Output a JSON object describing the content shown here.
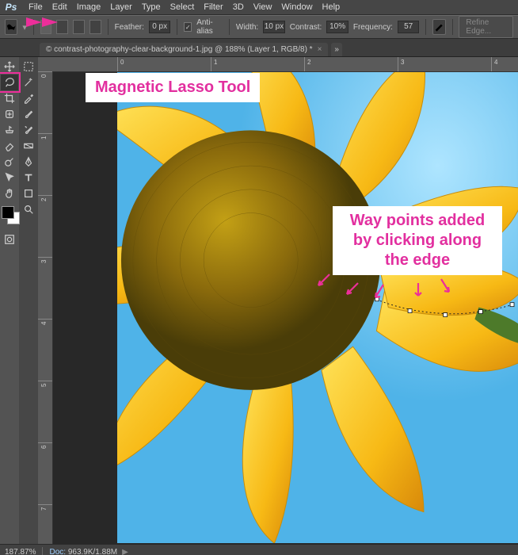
{
  "logo": "Ps",
  "menu": [
    "File",
    "Edit",
    "Image",
    "Layer",
    "Type",
    "Select",
    "Filter",
    "3D",
    "View",
    "Window",
    "Help"
  ],
  "options": {
    "feather_label": "Feather:",
    "feather": "0 px",
    "anti_label": "Anti-alias",
    "anti_checked": "✓",
    "width_label": "Width:",
    "width": "10 px",
    "contrast_label": "Contrast:",
    "contrast": "10%",
    "frequency_label": "Frequency:",
    "frequency": "57",
    "refine": "Refine Edge..."
  },
  "tab": {
    "title": "© contrast-photography-clear-background-1.jpg @ 188% (Layer 1, RGB/8) *",
    "close": "×",
    "chevron": "»"
  },
  "ruler_h": [
    "0",
    "1",
    "2",
    "3",
    "4"
  ],
  "ruler_v": [
    "0",
    "1",
    "2",
    "3",
    "4",
    "5",
    "6",
    "7"
  ],
  "annotations": {
    "tool": "Magnetic Lasso Tool",
    "waypoints": "Way points added by clicking along the edge"
  },
  "status": {
    "zoom": "187.87%",
    "doc_label": "Doc:",
    "doc": "963.9K/1.88M",
    "chev": "▶"
  }
}
